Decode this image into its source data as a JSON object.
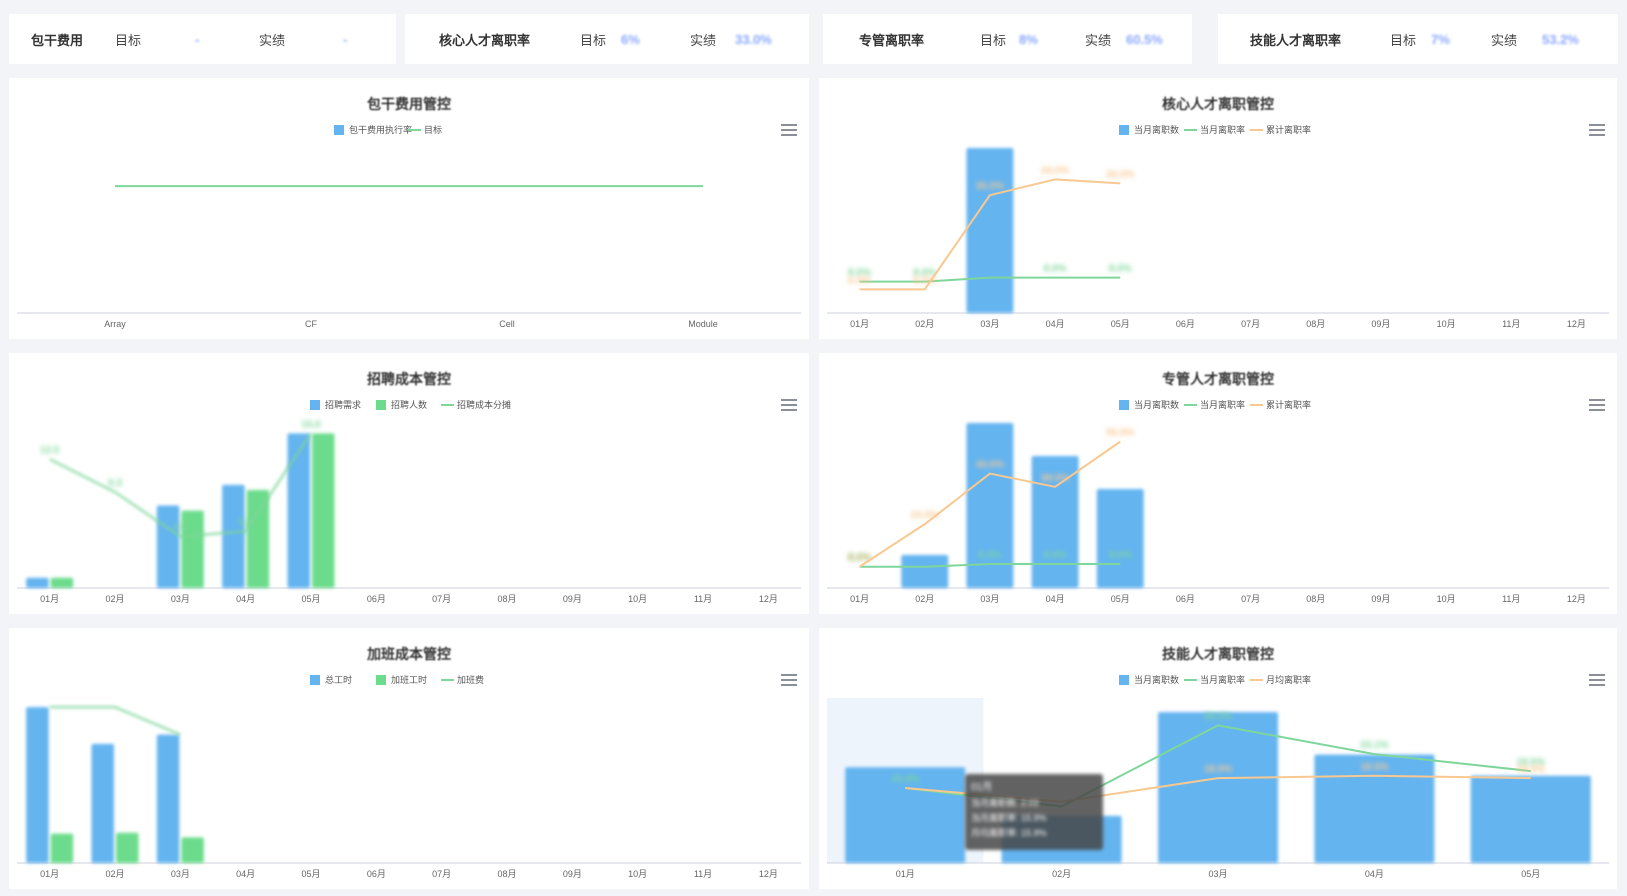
{
  "kpis": [
    {
      "title": "包干费用",
      "target_label": "目标",
      "target_value": "-",
      "actual_label": "实绩",
      "actual_value": "-"
    },
    {
      "title": "核心人才离职率",
      "target_label": "目标",
      "target_value": "6%",
      "actual_label": "实绩",
      "actual_value": "33.0%"
    },
    {
      "title": "专管离职率",
      "target_label": "目标",
      "target_value": "8%",
      "actual_label": "实绩",
      "actual_value": "60.5%"
    },
    {
      "title": "技能人才离职率",
      "target_label": "目标",
      "target_value": "7%",
      "actual_label": "实绩",
      "actual_value": "53.2%"
    }
  ],
  "colors": {
    "bar_blue": "#64b4f0",
    "bar_green": "#6cdc8c",
    "line_green": "#7ed69a",
    "line_orange": "#f8c890",
    "tooltip_bg": "#464646",
    "target_blue": "#8aa8ff"
  },
  "tooltip": {
    "title": "01月",
    "rows": [
      "当月离职数: 2.03",
      "当月离职率: 15.9%",
      "月均离职率: 15.9%"
    ]
  },
  "chart_data": [
    {
      "id": "c1",
      "type": "line",
      "title": "包干费用管控",
      "legend": [
        "包干费用执行率",
        "目标"
      ],
      "categories": [
        "Array",
        "CF",
        "Cell",
        "Module"
      ],
      "series": [
        {
          "name": "包干费用执行率",
          "type": "bar",
          "values": [
            null,
            null,
            null,
            null
          ]
        },
        {
          "name": "目标",
          "type": "line",
          "values": [
            100,
            100,
            100,
            100
          ]
        }
      ],
      "ylim": [
        0,
        130
      ]
    },
    {
      "id": "c2",
      "type": "bar",
      "title": "核心人才离职管控",
      "legend": [
        "当月离职数",
        "当月离职率",
        "累计离职率"
      ],
      "categories": [
        "01月",
        "02月",
        "03月",
        "04月",
        "05月",
        "06月",
        "07月",
        "08月",
        "09月",
        "10月",
        "11月",
        "12月"
      ],
      "series": [
        {
          "name": "当月离职数",
          "type": "bar",
          "values": [
            0,
            0,
            5,
            0,
            0,
            null,
            null,
            null,
            null,
            null,
            null,
            null
          ]
        },
        {
          "name": "当月离职率",
          "type": "line",
          "values": [
            8.0,
            8.0,
            9.0,
            9.0,
            9.0,
            null,
            null,
            null,
            null,
            null,
            null,
            null
          ],
          "labels": [
            "8.0%",
            "8.0%",
            "",
            "8.0%",
            "8.0%"
          ]
        },
        {
          "name": "累计离职率",
          "type": "line",
          "values": [
            6.0,
            6.0,
            30.0,
            34.0,
            33.0,
            null,
            null,
            null,
            null,
            null,
            null,
            null
          ],
          "labels": [
            "6.0%",
            "6.0%",
            "30.0%",
            "34.0%",
            "33.0%"
          ]
        }
      ],
      "ylim": [
        0,
        5
      ]
    },
    {
      "id": "c3",
      "type": "bar",
      "title": "招聘成本管控",
      "legend": [
        "招聘需求",
        "招聘人数",
        "招聘成本分摊"
      ],
      "categories": [
        "01月",
        "02月",
        "03月",
        "04月",
        "05月",
        "06月",
        "07月",
        "08月",
        "09月",
        "10月",
        "11月",
        "12月"
      ],
      "series": [
        {
          "name": "招聘需求",
          "type": "bar",
          "values": [
            1,
            0,
            8,
            10,
            15,
            null,
            null,
            null,
            null,
            null,
            null,
            null
          ]
        },
        {
          "name": "招聘人数",
          "type": "bar",
          "values": [
            1,
            0,
            7.5,
            9.5,
            15,
            null,
            null,
            null,
            null,
            null,
            null,
            null
          ]
        },
        {
          "name": "招聘成本分摊",
          "type": "line",
          "values": [
            12.5,
            9.3,
            5.0,
            5.5,
            15.0,
            null,
            null,
            null,
            null,
            null,
            null,
            null
          ],
          "labels": [
            "12.5",
            "9.3",
            "5.0",
            "5.5",
            "15.0"
          ]
        }
      ],
      "ylim": [
        0,
        16
      ]
    },
    {
      "id": "c4",
      "type": "bar",
      "title": "专管人才离职管控",
      "legend": [
        "当月离职数",
        "当月离职率",
        "累计离职率"
      ],
      "categories": [
        "01月",
        "02月",
        "03月",
        "04月",
        "05月",
        "06月",
        "07月",
        "08月",
        "09月",
        "10月",
        "11月",
        "12月"
      ],
      "series": [
        {
          "name": "当月离职数",
          "type": "bar",
          "values": [
            0,
            1,
            5,
            4,
            3,
            null,
            null,
            null,
            null,
            null,
            null,
            null
          ]
        },
        {
          "name": "当月离职率",
          "type": "line",
          "values": [
            8.0,
            8.0,
            9.0,
            9.0,
            9.0,
            null,
            null,
            null,
            null,
            null,
            null,
            null
          ],
          "labels": [
            "8.0%",
            "",
            "8.0%",
            "8.0%",
            "8.0%"
          ]
        },
        {
          "name": "累计离职率",
          "type": "line",
          "values": [
            8.0,
            24.0,
            43.0,
            38.0,
            55.0,
            null,
            null,
            null,
            null,
            null,
            null,
            null
          ],
          "labels": [
            "8.0%",
            "24.0%",
            "43.0%",
            "38.0%",
            "55.0%"
          ]
        }
      ],
      "ylim": [
        0,
        5
      ]
    },
    {
      "id": "c5",
      "type": "bar",
      "title": "加班成本管控",
      "legend": [
        "总工时",
        "加班工时",
        "加班费"
      ],
      "categories": [
        "01月",
        "02月",
        "03月",
        "04月",
        "05月",
        "06月",
        "07月",
        "08月",
        "09月",
        "10月",
        "11月",
        "12月"
      ],
      "series": [
        {
          "name": "总工时",
          "type": "bar",
          "values": [
            17,
            13,
            14,
            null,
            null,
            null,
            null,
            null,
            null,
            null,
            null,
            null
          ]
        },
        {
          "name": "加班工时",
          "type": "bar",
          "values": [
            3.2,
            3.3,
            2.8,
            null,
            null,
            null,
            null,
            null,
            null,
            null,
            null,
            null
          ]
        },
        {
          "name": "加班费",
          "type": "line",
          "values": [
            17,
            17,
            14,
            null,
            null,
            null,
            null,
            null,
            null,
            null,
            null,
            null
          ],
          "labels": [
            "",
            "",
            ""
          ]
        }
      ],
      "ylim": [
        0,
        18
      ]
    },
    {
      "id": "c6",
      "type": "bar",
      "title": "技能人才离职管控",
      "legend": [
        "当月离职数",
        "当月离职率",
        "月均离职率"
      ],
      "categories": [
        "01月",
        "02月",
        "03月",
        "04月",
        "05月"
      ],
      "series": [
        {
          "name": "当月离职数",
          "type": "bar",
          "values": [
            2.03,
            1.0,
            3.2,
            2.3,
            1.85
          ]
        },
        {
          "name": "当月离职率",
          "type": "line",
          "values": [
            15.9,
            12.0,
            29.2,
            23.1,
            19.5
          ],
          "labels": [
            "15.9%",
            "",
            "29.2%",
            "23.1%",
            "19.5%"
          ]
        },
        {
          "name": "月均离职率",
          "type": "line",
          "values": [
            15.9,
            13.0,
            18.0,
            18.5,
            18.0
          ],
          "labels": [
            "",
            "",
            "18.0%",
            "18.5%",
            "18.0%"
          ]
        }
      ],
      "ylim": [
        0,
        3.5
      ]
    }
  ]
}
